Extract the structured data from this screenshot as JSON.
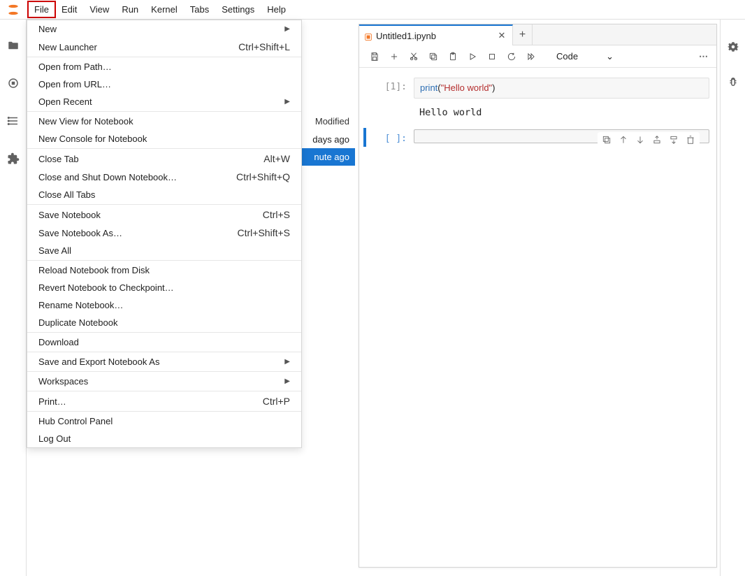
{
  "menubar": [
    "File",
    "Edit",
    "View",
    "Run",
    "Kernel",
    "Tabs",
    "Settings",
    "Help"
  ],
  "file_menu": {
    "groups": [
      [
        {
          "label": "New",
          "submenu": true
        },
        {
          "label": "New Launcher",
          "shortcut": "Ctrl+Shift+L"
        }
      ],
      [
        {
          "label": "Open from Path…"
        },
        {
          "label": "Open from URL…"
        },
        {
          "label": "Open Recent",
          "submenu": true
        }
      ],
      [
        {
          "label": "New View for Notebook"
        },
        {
          "label": "New Console for Notebook"
        }
      ],
      [
        {
          "label": "Close Tab",
          "shortcut": "Alt+W"
        },
        {
          "label": "Close and Shut Down Notebook…",
          "shortcut": "Ctrl+Shift+Q"
        },
        {
          "label": "Close All Tabs"
        }
      ],
      [
        {
          "label": "Save Notebook",
          "shortcut": "Ctrl+S"
        },
        {
          "label": "Save Notebook As…",
          "shortcut": "Ctrl+Shift+S"
        },
        {
          "label": "Save All"
        }
      ],
      [
        {
          "label": "Reload Notebook from Disk"
        },
        {
          "label": "Revert Notebook to Checkpoint…"
        },
        {
          "label": "Rename Notebook…"
        },
        {
          "label": "Duplicate Notebook"
        }
      ],
      [
        {
          "label": "Download"
        }
      ],
      [
        {
          "label": "Save and Export Notebook As",
          "submenu": true
        }
      ],
      [
        {
          "label": "Workspaces",
          "submenu": true
        }
      ],
      [
        {
          "label": "Print…",
          "shortcut": "Ctrl+P"
        }
      ],
      [
        {
          "label": "Hub Control Panel"
        },
        {
          "label": "Log Out"
        }
      ]
    ]
  },
  "file_panel": {
    "header": "Modified",
    "rows": [
      {
        "text": "days ago",
        "selected": false
      },
      {
        "text": "nute ago",
        "selected": true
      }
    ]
  },
  "notebook": {
    "tab_title": "Untitled1.ipynb",
    "cell_type": "Code",
    "cells": [
      {
        "prompt": "[1]:",
        "code": {
          "fn": "print",
          "open": "(",
          "str": "\"Hello world\"",
          "close": ")"
        },
        "output": "Hello world",
        "active": false
      },
      {
        "prompt": "[ ]:",
        "code": null,
        "output": null,
        "active": true
      }
    ]
  }
}
